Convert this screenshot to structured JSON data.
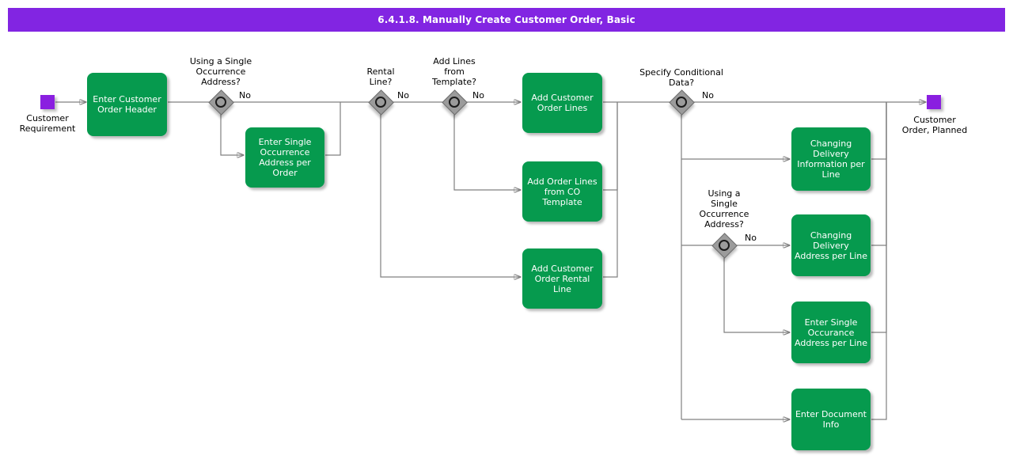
{
  "header": {
    "title": "6.4.1.8. Manually Create Customer Order, Basic",
    "banner_color": "#8225e2"
  },
  "theme": {
    "task_fill": "#069a4e",
    "task_text": "#ffffff",
    "event_fill": "#8a1fe0",
    "gateway_fill": "#9b9b9b",
    "gateway_ring": "#1a1a1a",
    "connector": "#808080",
    "page_background": "#ffffff"
  },
  "diagram": {
    "type": "bpmn-process-flow",
    "events": [
      {
        "id": "start",
        "name": "Customer Requirement",
        "label": "Customer\nRequirement",
        "kind": "start"
      },
      {
        "id": "end",
        "name": "Customer Order, Planned",
        "label": "Customer\nOrder, Planned",
        "kind": "end"
      }
    ],
    "gateways": [
      {
        "id": "gw1",
        "label": "Using a Single\nOccurrence\nAddress?",
        "kind": "inclusive",
        "branch_label": "No"
      },
      {
        "id": "gw2",
        "label": "Rental\nLine?",
        "kind": "inclusive",
        "branch_label": "No"
      },
      {
        "id": "gw3",
        "label": "Add Lines\nfrom\nTemplate?",
        "kind": "inclusive",
        "branch_label": "No"
      },
      {
        "id": "gw4",
        "label": "Specify Conditional\nData?",
        "kind": "inclusive",
        "branch_label": "No"
      },
      {
        "id": "gw5",
        "label": "Using a\nSingle\nOccurrence\nAddress?",
        "kind": "inclusive",
        "branch_label": "No"
      }
    ],
    "tasks": [
      {
        "id": "t1",
        "label": "Enter Customer\nOrder Header"
      },
      {
        "id": "t2",
        "label": "Enter Single\nOccurrence\nAddress per\nOrder"
      },
      {
        "id": "t3",
        "label": "Add Customer\nOrder Lines"
      },
      {
        "id": "t4",
        "label": "Add Order Lines\nfrom CO\nTemplate"
      },
      {
        "id": "t5",
        "label": "Add Customer\nOrder Rental\nLine"
      },
      {
        "id": "t6",
        "label": "Changing\nDelivery\nInformation per\nLine"
      },
      {
        "id": "t7",
        "label": "Changing\nDelivery\nAddress per Line"
      },
      {
        "id": "t8",
        "label": "Enter Single\nOccurance\nAddress per Line"
      },
      {
        "id": "t9",
        "label": "Enter Document\nInfo"
      }
    ]
  }
}
